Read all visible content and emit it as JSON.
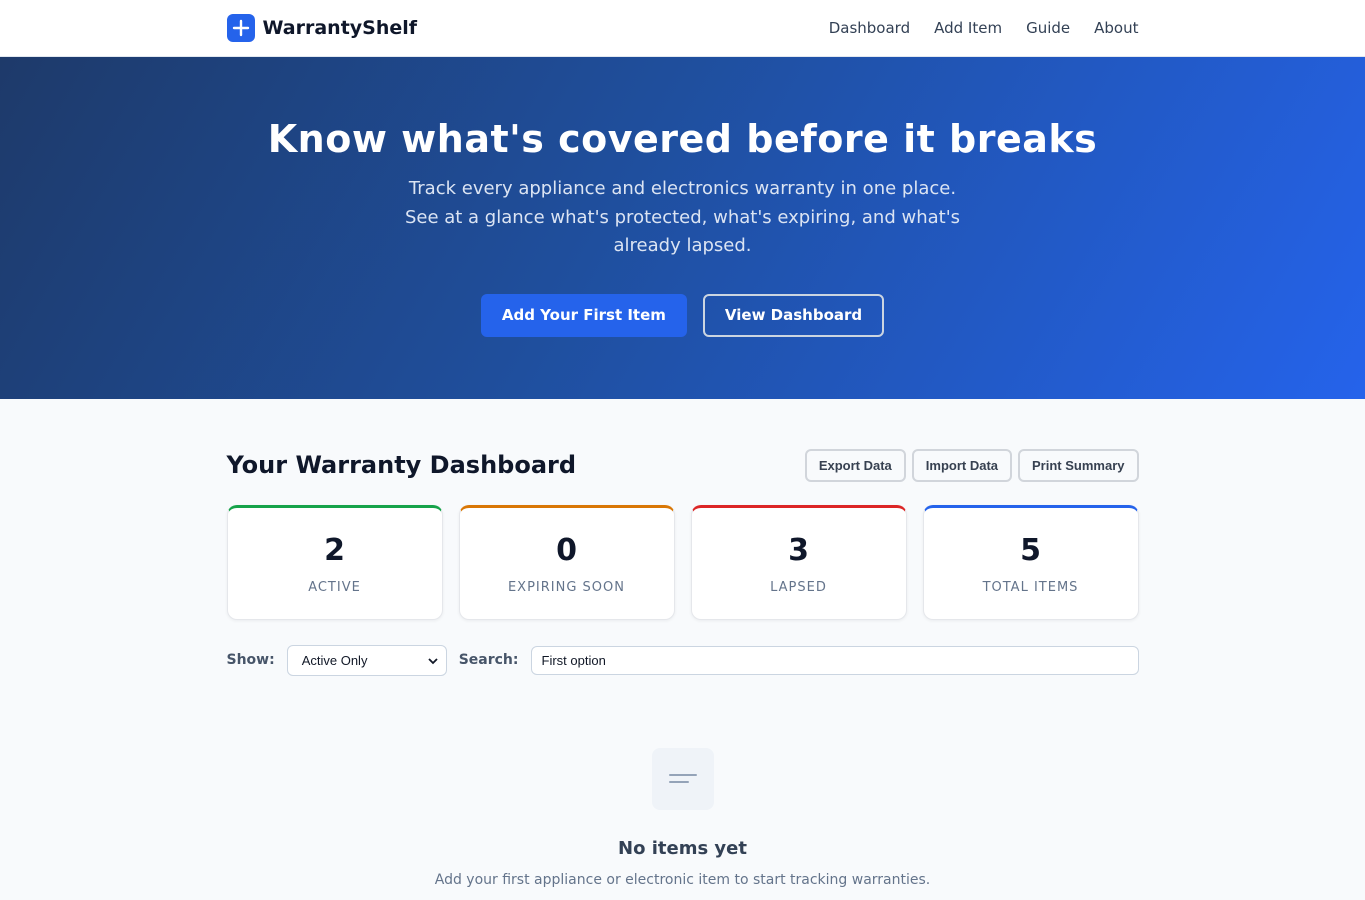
{
  "brand": {
    "name": "WarrantyShelf",
    "logo_icon": "plus-icon",
    "logo_color": "#2563eb"
  },
  "nav": {
    "items": [
      "Dashboard",
      "Add Item",
      "Guide",
      "About"
    ]
  },
  "hero": {
    "title": "Know what's covered before it breaks",
    "subtitle": "Track every appliance and electronics warranty in one place. See at a glance what's protected, what's expiring, and what's already lapsed.",
    "primary_button": "Add Your First Item",
    "secondary_button": "View Dashboard"
  },
  "dashboard": {
    "title": "Your Warranty Dashboard",
    "tools": [
      "Export Data",
      "Import Data",
      "Print Summary"
    ],
    "stats": [
      {
        "value": "2",
        "label": "ACTIVE",
        "color": "#16a34a"
      },
      {
        "value": "0",
        "label": "EXPIRING SOON",
        "color": "#d97706"
      },
      {
        "value": "3",
        "label": "LAPSED",
        "color": "#dc2626"
      },
      {
        "value": "5",
        "label": "TOTAL ITEMS",
        "color": "#2563eb"
      }
    ],
    "filters": {
      "show_label": "Show:",
      "show_value": "Active Only",
      "search_label": "Search:",
      "search_value": "First option"
    },
    "empty_state": {
      "icon": "list-icon",
      "title": "No items yet",
      "text": "Add your first appliance or electronic item to start tracking warranties."
    }
  }
}
